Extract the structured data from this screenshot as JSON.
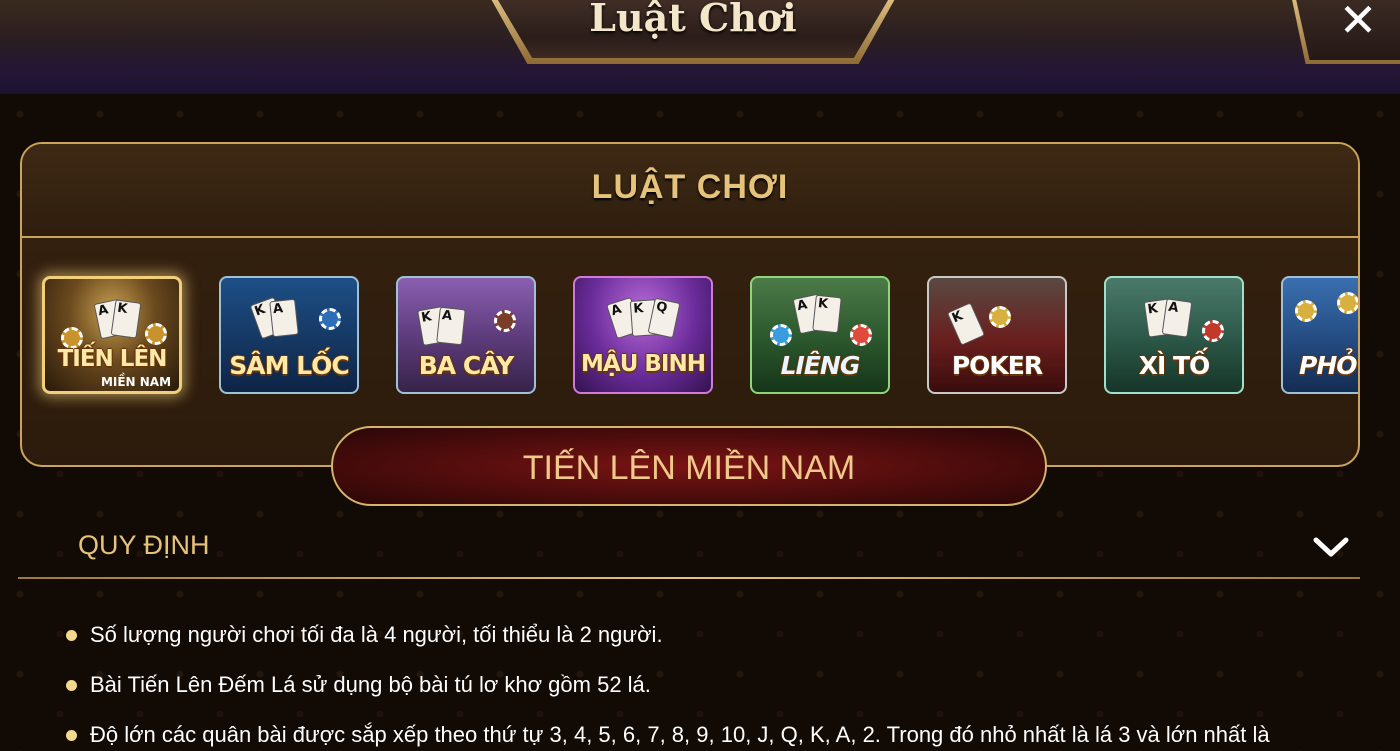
{
  "window": {
    "title": "Luật Chơi",
    "close_label": "✕"
  },
  "panel": {
    "heading": "LUẬT CHƠI"
  },
  "games": [
    {
      "id": "tien-len",
      "label": "TIẾN LÊN",
      "sublabel": "MIỀN NAM",
      "selected": true
    },
    {
      "id": "sam-loc",
      "label": "SÂM LỐC",
      "sublabel": "",
      "selected": false
    },
    {
      "id": "ba-cay",
      "label": "BA CÂY",
      "sublabel": "",
      "selected": false
    },
    {
      "id": "mau-binh",
      "label": "MẬU BINH",
      "sublabel": "",
      "selected": false
    },
    {
      "id": "lieng",
      "label": "LIÊNG",
      "sublabel": "",
      "selected": false
    },
    {
      "id": "poker",
      "label": "POKER",
      "sublabel": "",
      "selected": false
    },
    {
      "id": "xi-to",
      "label": "XÌ TỐ",
      "sublabel": "",
      "selected": false
    },
    {
      "id": "phom",
      "label": "PHỎ",
      "sublabel": "",
      "selected": false
    }
  ],
  "selected_game": {
    "name": "TIẾN LÊN MIỀN NAM"
  },
  "section": {
    "title": "QUY ĐỊNH"
  },
  "rules": [
    "Số lượng người chơi tối đa là 4 người, tối thiểu là 2 người.",
    "Bài Tiến Lên Đếm Lá sử dụng bộ bài tú lơ khơ gồm 52 lá.",
    "Độ lớn các quân bài được sắp xếp theo thứ tự 3, 4, 5, 6, 7, 8, 9, 10, J, Q, K, A, 2. Trong đó nhỏ nhất là lá 3 và lớn nhất là"
  ],
  "colors": {
    "gold": "#e6c37a",
    "panel_border": "#c9a45a",
    "banner_red": "#7a1414",
    "bullet": "#f2d98e"
  }
}
